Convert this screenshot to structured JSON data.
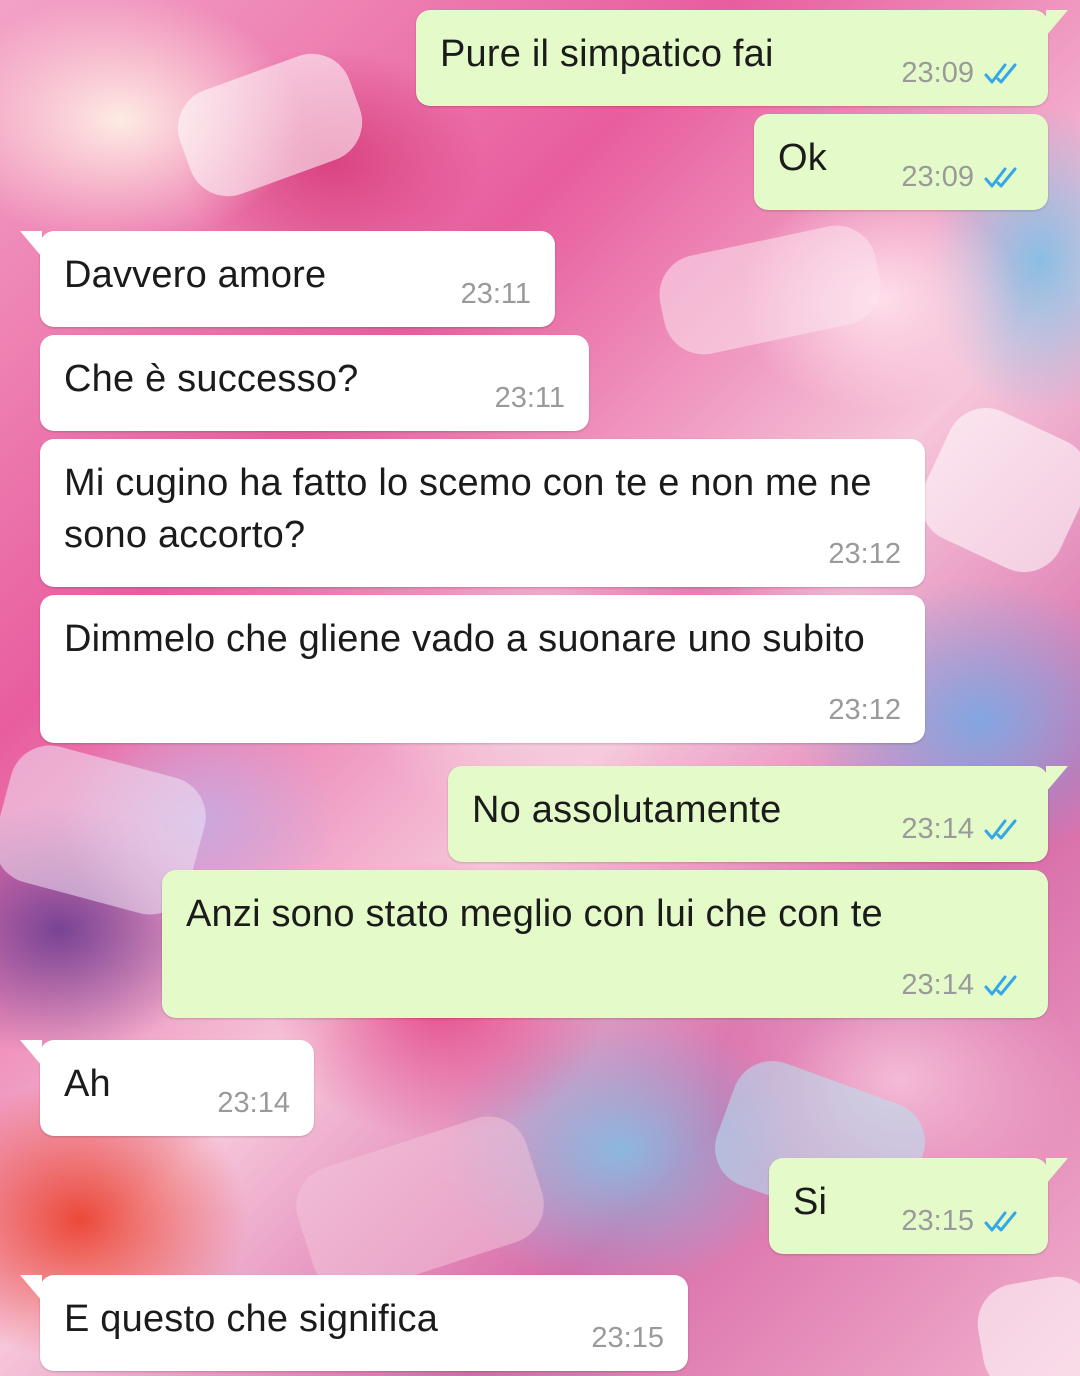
{
  "colors": {
    "incoming_bubble": "#ffffff",
    "outgoing_bubble": "#e4fbc9",
    "timestamp": "#9a9a9a",
    "read_ticks": "#34a8e6"
  },
  "messages": [
    {
      "direction": "out",
      "text": "Pure il simpatico fai",
      "time": "23:09",
      "status": "read-ticks-icon"
    },
    {
      "direction": "out",
      "text": "Ok",
      "time": "23:09",
      "status": "read-ticks-icon"
    },
    {
      "direction": "in",
      "text": "Davvero amore",
      "time": "23:11"
    },
    {
      "direction": "in",
      "text": "Che è successo?",
      "time": "23:11"
    },
    {
      "direction": "in",
      "text": "Mi cugino ha fatto lo scemo con te e non me ne sono accorto?",
      "time": "23:12"
    },
    {
      "direction": "in",
      "text": "Dimmelo che gliene vado a suonare uno subito",
      "time": "23:12"
    },
    {
      "direction": "out",
      "text": "No assolutamente",
      "time": "23:14",
      "status": "read-ticks-icon"
    },
    {
      "direction": "out",
      "text": "Anzi sono stato meglio con lui che con te",
      "time": "23:14",
      "status": "read-ticks-icon"
    },
    {
      "direction": "in",
      "text": "Ah",
      "time": "23:14"
    },
    {
      "direction": "out",
      "text": "Si",
      "time": "23:15",
      "status": "read-ticks-icon"
    },
    {
      "direction": "in",
      "text": "E questo che significa",
      "time": "23:15"
    }
  ]
}
